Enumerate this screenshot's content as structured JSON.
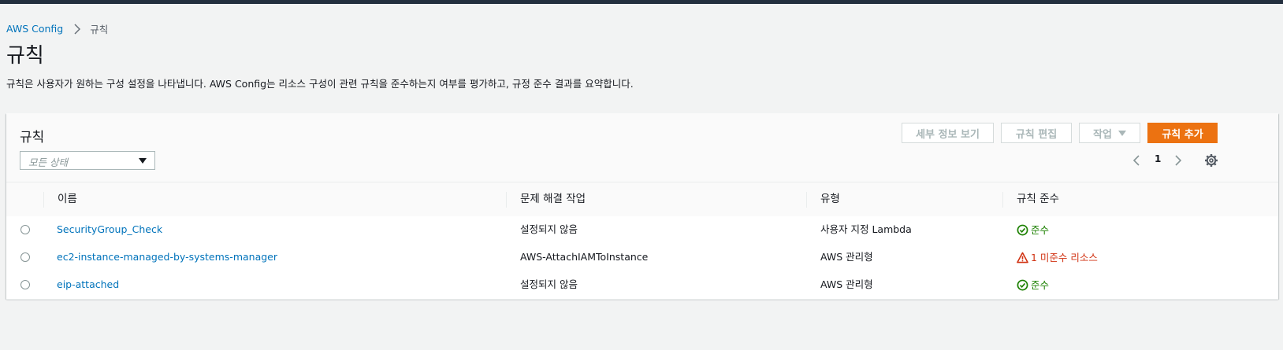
{
  "breadcrumb": {
    "root": "AWS Config",
    "current": "규칙"
  },
  "page": {
    "title": "규칙",
    "description": "규칙은 사용자가 원하는 구성 설정을 나타냅니다. AWS Config는 리소스 구성이 관련 규칙을 준수하는지 여부를 평가하고, 규정 준수 결과를 요약합니다."
  },
  "panel": {
    "title": "규칙",
    "filter_placeholder": "모든 상태",
    "buttons": {
      "details": "세부 정보 보기",
      "edit": "규칙 편집",
      "actions": "작업",
      "add": "규칙 추가"
    },
    "page_number": "1"
  },
  "table": {
    "columns": [
      "이름",
      "문제 해결 작업",
      "유형",
      "규칙 준수"
    ],
    "rows": [
      {
        "name": "SecurityGroup_Check",
        "remediation": "설정되지 않음",
        "type": "사용자 지정 Lambda",
        "compliance": "준수",
        "status": "compliant"
      },
      {
        "name": "ec2-instance-managed-by-systems-manager",
        "remediation": "AWS-AttachIAMToInstance",
        "type": "AWS 관리형",
        "compliance": "1 미준수 리소스",
        "status": "noncompliant"
      },
      {
        "name": "eip-attached",
        "remediation": "설정되지 않음",
        "type": "AWS 관리형",
        "compliance": "준수",
        "status": "compliant"
      }
    ]
  },
  "colors": {
    "link": "#0073bb",
    "primary": "#ec7211",
    "compliant": "#1d8102",
    "noncompliant": "#d13212",
    "topbar": "#232f3e"
  },
  "icons": {
    "compliant": "check-circle-icon",
    "noncompliant": "warning-triangle-icon"
  }
}
